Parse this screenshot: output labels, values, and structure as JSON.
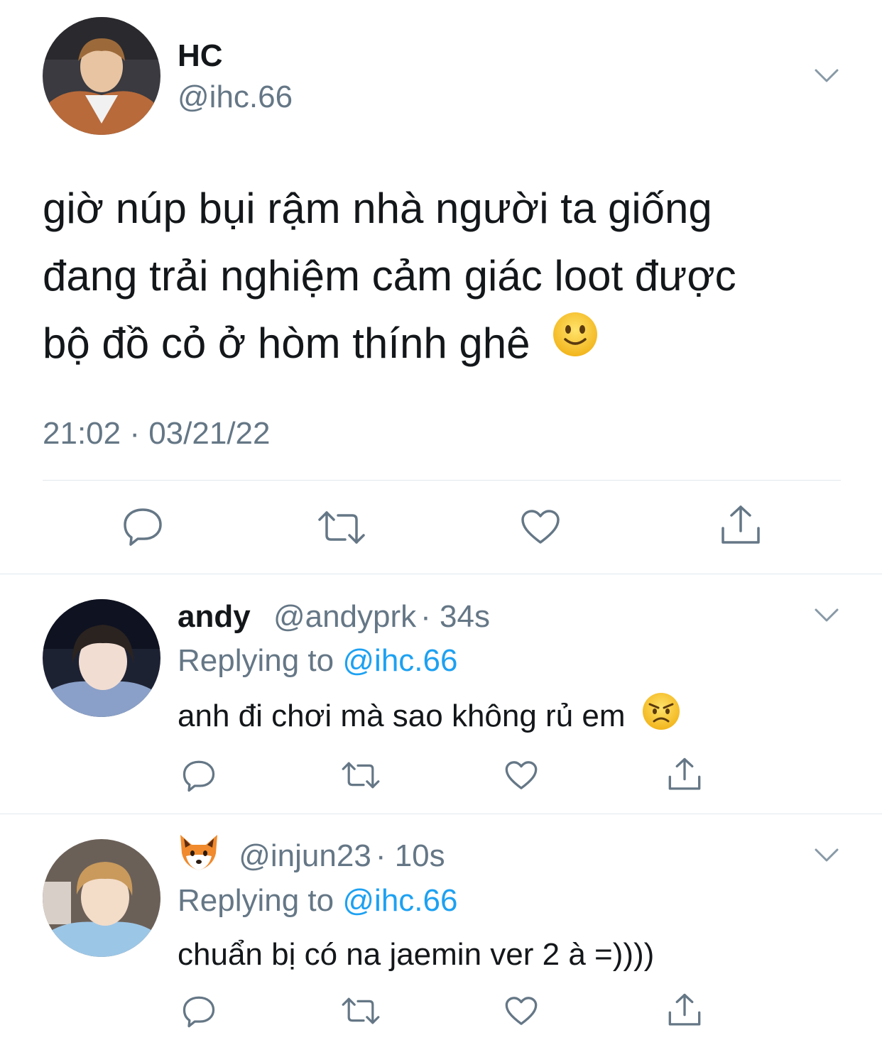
{
  "main_tweet": {
    "display_name": "HC",
    "handle": "@ihc.66",
    "text_lines": [
      "giờ núp bụi rậm nhà người ta giống",
      "đang trải nghiệm cảm giác loot được",
      "bộ đồ cỏ ở hòm thính ghê"
    ],
    "emoji": "slightly-smiling-face",
    "timestamp": "21:02 · 03/21/22"
  },
  "replies": [
    {
      "display_name": "andy",
      "handle": "@andyprk",
      "time": "· 34s",
      "replying_prefix": "Replying to",
      "replying_handle": "@ihc.66",
      "text": "anh đi chơi mà sao không rủ em",
      "emoji": "angry-face"
    },
    {
      "display_name_emoji": "fox-face",
      "handle": "@injun23",
      "time": "· 10s",
      "replying_prefix": "Replying to",
      "replying_handle": "@ihc.66",
      "text": "chuẩn bị có na jaemin ver 2 à =))))"
    }
  ],
  "colors": {
    "text": "#14171a",
    "secondary": "#657786",
    "link": "#1da1f2",
    "separator": "#e1e8ed"
  },
  "icons": [
    "reply-icon",
    "retweet-icon",
    "like-icon",
    "share-icon",
    "chevron-down-icon"
  ]
}
